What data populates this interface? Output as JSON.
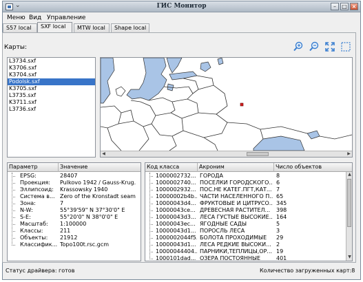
{
  "window": {
    "title": "ГИС Монитор",
    "menu": [
      "Меню",
      "Вид",
      "Управление"
    ]
  },
  "tabs": [
    {
      "label": "S57 local",
      "active": false
    },
    {
      "label": "SXF local",
      "active": true
    },
    {
      "label": "MTW local",
      "active": false
    },
    {
      "label": "Shape local",
      "active": false
    }
  ],
  "maps": {
    "label": "Карты:",
    "items": [
      "L3734.sxf",
      "K3706.sxf",
      "K3704.sxf",
      "Podolsk.sxf",
      "K3705.sxf",
      "L3735.sxf",
      "K3711.sxf",
      "L3736.sxf"
    ],
    "selected_index": 3
  },
  "toolbar": {
    "icons": [
      "zoom-in-icon",
      "zoom-out-icon",
      "fit-extent-icon",
      "select-region-icon"
    ]
  },
  "properties": {
    "headers": [
      "Параметр",
      "Значение"
    ],
    "rows": [
      [
        "EPSG:",
        "28407"
      ],
      [
        "Проекция:",
        "Pulkovo 1942 / Gauss-Krug..."
      ],
      [
        "Эллипсоид:",
        "Krassowsky 1940"
      ],
      [
        "Система в...",
        "Zero of the Kronstadt seam..."
      ],
      [
        "Зона:",
        "7"
      ],
      [
        "N-W:",
        "55°39'59\" N 37°30'0\" E"
      ],
      [
        "S-E:",
        "55°20'0\" N 38°0'0\" E"
      ],
      [
        "Масштаб:",
        "1:100000"
      ],
      [
        "Классы:",
        "211"
      ],
      [
        "Объекты:",
        "21912"
      ],
      [
        "Классифик...",
        "Topo100t.rsc.gcm"
      ]
    ]
  },
  "classes": {
    "headers": [
      "Код класса",
      "Акроним",
      "Число объектов"
    ],
    "rows": [
      [
        "1000002732...",
        "ГОРОДА",
        "8"
      ],
      [
        "1000002740...",
        "ПОСЕЛКИ ГОРОДСКОГО...",
        "6"
      ],
      [
        "1000002932...",
        "ПОС.НЕ КАТЕГ.ПГТ,КАТ...",
        "7"
      ],
      [
        "10000002b4b...",
        "ЧАСТИ НАСЕЛЕННОГО П...",
        "65"
      ],
      [
        "10000043d4...",
        "ФРУКТОВЫЕ И ЦИТРУСО...",
        "345"
      ],
      [
        "10000043ce...",
        "ДРЕВЕСНАЯ РАСТИТЕЛ...",
        "398"
      ],
      [
        "10000043d3...",
        "ЛЕСА ГУСТЫЕ ВЫСОКИЕ...",
        "164"
      ],
      [
        "10000043ec...",
        "ЯГОДНЫЕ САДЫ",
        "5"
      ],
      [
        "10000043d1...",
        "ПОРОСЛЬ ЛЕСА",
        "3"
      ],
      [
        "1000002044f5...",
        "БОЛОТА ПРОХОДИМЫЕ",
        "29"
      ],
      [
        "10000043d1...",
        "ЛЕСА РЕДКИЕ ВЫСОКИ...",
        "2"
      ],
      [
        "10000044404...",
        "ПАРНИКИ,ТЕПЛИЦЫ,ОР...",
        "19"
      ],
      [
        "1000101dad...",
        "ОЗЕРА ПОСТОЯННЫЕ",
        "401"
      ]
    ]
  },
  "status": {
    "driver": "Статус драйвера: готов",
    "loaded": "Количество загруженных карт:8"
  },
  "colors": {
    "selection": "#3874c8",
    "water": "#a9c4e6",
    "accent_icon": "#3a7fd0"
  }
}
